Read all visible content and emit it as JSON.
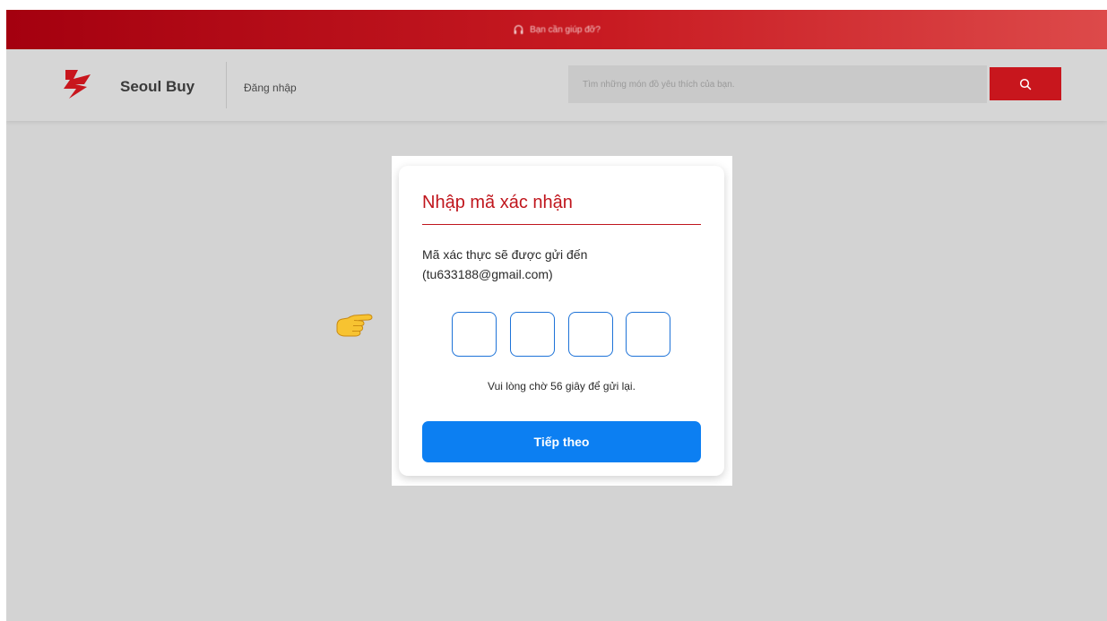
{
  "topbar": {
    "help_text": "Bạn cần giúp đỡ?",
    "icon": "headset-icon"
  },
  "header": {
    "brand": "Seoul Buy",
    "login_link": "Đăng nhập",
    "search_placeholder": "Tìm những món đồ yêu thích của bạn.",
    "search_icon": "search-icon",
    "brand_color": "#c8161d"
  },
  "verify": {
    "title": "Nhập mã xác nhận",
    "desc_line1": "Mã xác thực sẽ được gửi đến",
    "desc_line2": "(tu633188@gmail.com)",
    "code_digits": [
      "",
      "",
      "",
      ""
    ],
    "wait_text": "Vui lòng chờ 56 giây để gửi lại.",
    "next_button": "Tiếp theo",
    "accent_color": "#0c7ff2"
  },
  "pointer_icon": "pointing-hand-icon"
}
